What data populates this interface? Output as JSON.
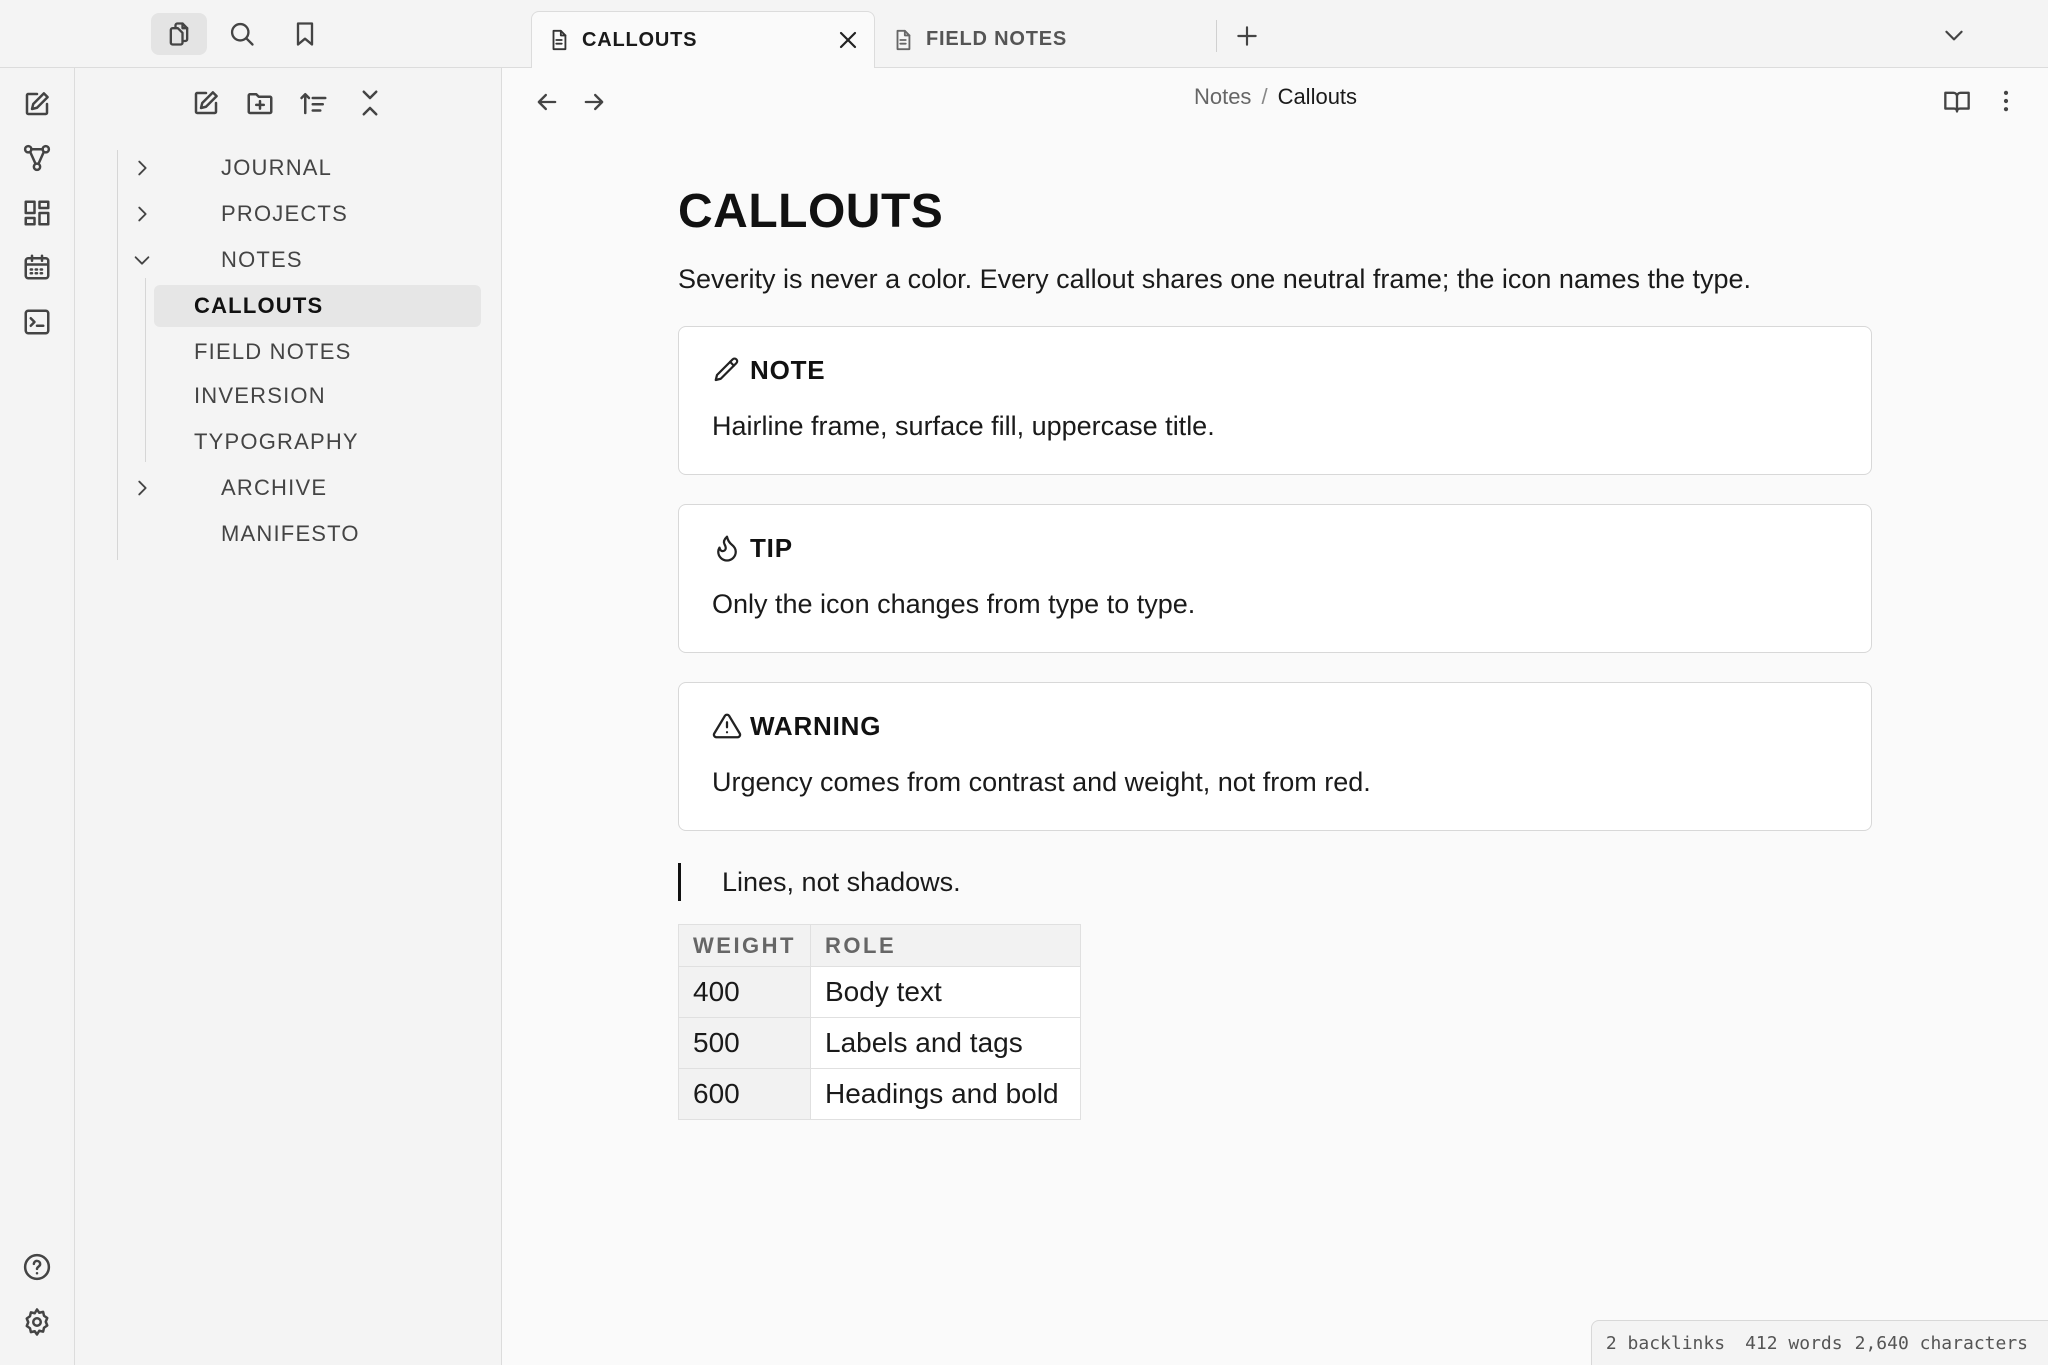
{
  "tabs": [
    {
      "label": "CALLOUTS",
      "active": true,
      "icon": "document-icon"
    },
    {
      "label": "FIELD NOTES",
      "active": false,
      "icon": "document-icon"
    }
  ],
  "explorer": {
    "tree": [
      {
        "label": "JOURNAL",
        "type": "folder",
        "expanded": false
      },
      {
        "label": "PROJECTS",
        "type": "folder",
        "expanded": false
      },
      {
        "label": "NOTES",
        "type": "folder",
        "expanded": true
      },
      {
        "label": "CALLOUTS",
        "type": "file",
        "selected": true
      },
      {
        "label": "FIELD NOTES",
        "type": "file"
      },
      {
        "label": "INVERSION",
        "type": "file"
      },
      {
        "label": "TYPOGRAPHY",
        "type": "file"
      },
      {
        "label": "ARCHIVE",
        "type": "folder",
        "expanded": false
      },
      {
        "label": "MANIFESTO",
        "type": "file"
      }
    ]
  },
  "breadcrumb": {
    "parent": "Notes",
    "separator": "/",
    "current": "Callouts"
  },
  "document": {
    "title": "CALLOUTS",
    "intro": "Severity is never a color. Every callout shares one neutral frame; the icon names the type.",
    "callouts": [
      {
        "title": "NOTE",
        "icon": "pencil-icon",
        "body": "Hairline frame, surface fill, uppercase title."
      },
      {
        "title": "TIP",
        "icon": "flame-icon",
        "body": "Only the icon changes from type to type."
      },
      {
        "title": "WARNING",
        "icon": "warning-triangle-icon",
        "body": "Urgency comes from contrast and weight, not from red."
      }
    ],
    "quote": "Lines, not shadows.",
    "table": {
      "headers": [
        "WEIGHT",
        "ROLE"
      ],
      "rows": [
        [
          "400",
          "Body text"
        ],
        [
          "500",
          "Labels and tags"
        ],
        [
          "600",
          "Headings and bold"
        ]
      ]
    }
  },
  "status": {
    "backlinks": "2 backlinks",
    "words": "412 words",
    "characters": "2,640 characters"
  },
  "colors": {
    "background": "#fafafa",
    "chrome": "#f4f4f4",
    "border": "#dcdcdc",
    "text": "#1a1a1a"
  }
}
